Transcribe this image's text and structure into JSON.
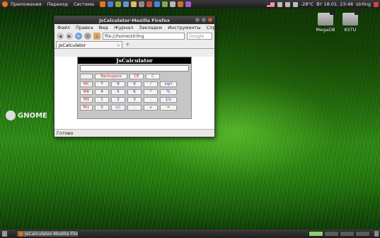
{
  "top_panel": {
    "menus": [
      "Приложения",
      "Переход",
      "Система"
    ],
    "weather": "-28°C",
    "clock": "Вт 18.01, 23:48",
    "user": "str0ng"
  },
  "desktop": {
    "icons": [
      {
        "label": "MegaDB"
      },
      {
        "label": "KSTU"
      }
    ],
    "gnome_logo": "GNOME"
  },
  "firefox": {
    "title": "JsCalculator-Mozilla Firefox",
    "menu": [
      "Файл",
      "Правка",
      "Вид",
      "Журнал",
      "Закладки",
      "Инструменты",
      "Справка"
    ],
    "url": "file:///home/str0ng",
    "search_placeholder": "Google",
    "tab_label": "JsCalculator",
    "status": "Готово"
  },
  "calculator": {
    "title": "JsCalculator",
    "display": "",
    "top_row": [
      "Backspace",
      "CE",
      "C"
    ],
    "rows": [
      [
        "MC",
        "7",
        "8",
        "9",
        "/",
        "sqrt"
      ],
      [
        "MR",
        "4",
        "5",
        "6",
        "*",
        "%"
      ],
      [
        "MS",
        "1",
        "2",
        "3",
        "-",
        "1/x"
      ],
      [
        "M+",
        "0",
        "+/-",
        ".",
        "+",
        "="
      ]
    ],
    "accent_red": "#c81e1e",
    "accent_blue": "#2a3aa0"
  },
  "bottom_panel": {
    "task_label": "JsCalculator-Mozilla Firef..."
  }
}
